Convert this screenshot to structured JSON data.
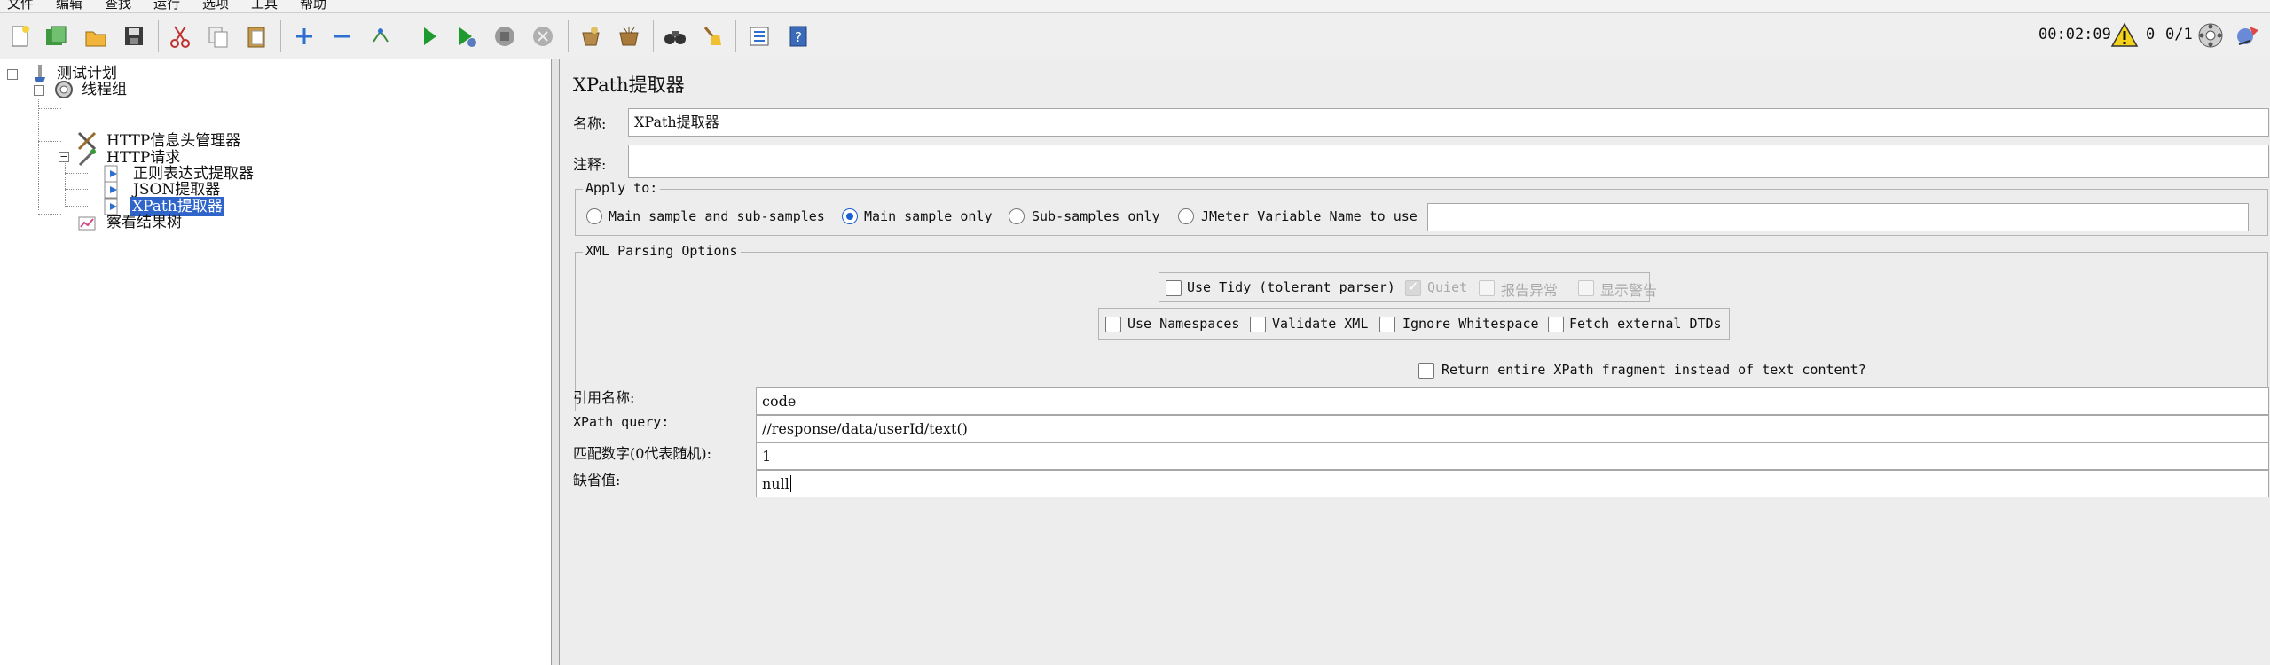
{
  "menu": [
    "文件",
    "编辑",
    "查找",
    "运行",
    "选项",
    "工具",
    "帮助"
  ],
  "status": {
    "elapsed": "00:02:09",
    "warning_count": "0",
    "threads": "0/1"
  },
  "icons": {
    "toolbar": [
      "new-icon",
      "templates-icon",
      "open-icon",
      "save-icon",
      "cut-icon",
      "copy-icon",
      "paste-icon",
      "expand-icon",
      "collapse-icon",
      "toggle-icon",
      "start-icon",
      "start-no-pause-icon",
      "stop-icon",
      "shutdown-icon",
      "clear-icon",
      "clear-all-icon",
      "search-icon",
      "reset-search-icon",
      "function-helper-icon",
      "help-icon"
    ]
  },
  "tree": {
    "root": "测试计划",
    "thread_group": "线程组",
    "header_manager": "HTTP信息头管理器",
    "http_request": "HTTP请求",
    "regex_extractor": "正则表达式提取器",
    "json_extractor": "JSON提取器",
    "xpath_extractor": "XPath提取器",
    "result_tree": "察看结果树"
  },
  "panel": {
    "title": "XPath提取器",
    "name_label": "名称:",
    "name_value": "XPath提取器",
    "comment_label": "注释:",
    "comment_value": "",
    "apply_to": {
      "title": "Apply to:",
      "options": [
        "Main sample and sub-samples",
        "Main sample only",
        "Sub-samples only",
        "JMeter Variable Name to use"
      ],
      "selected": "Main sample only",
      "variable_value": ""
    },
    "xml_parsing": {
      "title": "XML Parsing Options",
      "use_tidy": "Use Tidy (tolerant parser)",
      "quiet": "Quiet",
      "report_errors": "报告异常",
      "show_warnings": "显示警告",
      "use_namespaces": "Use Namespaces",
      "validate_xml": "Validate XML",
      "ignore_whitespace": "Ignore Whitespace",
      "fetch_dtds": "Fetch external DTDs"
    },
    "return_fragment": "Return entire XPath fragment instead of text content?",
    "ref_name_label": "引用名称:",
    "ref_name_value": "code",
    "xpath_query_label": "XPath query:",
    "xpath_query_value": "//response/data/userId/text()",
    "match_no_label": "匹配数字(0代表随机):",
    "match_no_value": "1",
    "default_label": "缺省值:",
    "default_value": "null"
  }
}
